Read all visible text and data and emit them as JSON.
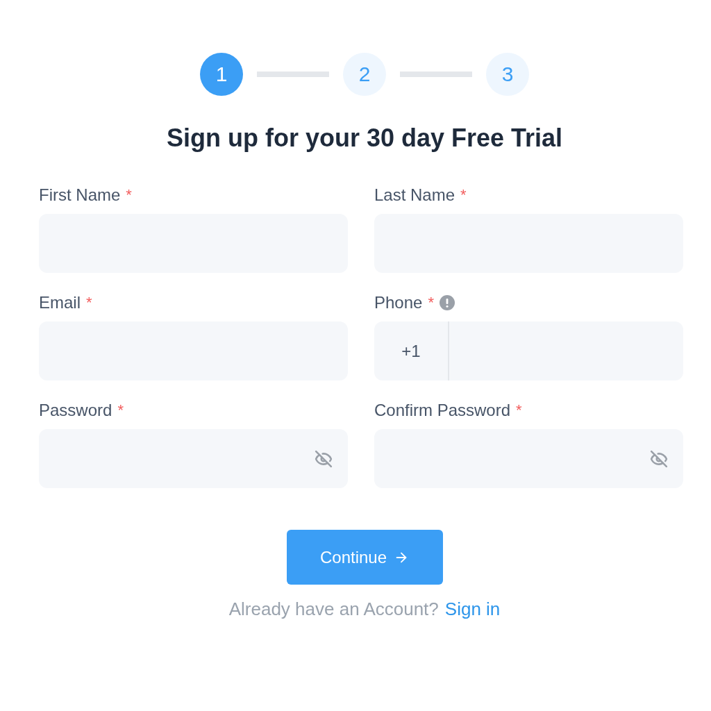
{
  "steps": [
    {
      "label": "1",
      "selected": true
    },
    {
      "label": "2",
      "selected": false
    },
    {
      "label": "3",
      "selected": false
    }
  ],
  "title": "Sign up for your 30 day Free Trial",
  "fields": [
    {
      "label": "First Name",
      "marker": "*",
      "kind": "text"
    },
    {
      "label": "Last Name",
      "marker": "*",
      "kind": "text"
    },
    {
      "label": "Email",
      "marker": "*",
      "kind": "text"
    },
    {
      "label": "Phone",
      "marker": "*",
      "kind": "phone",
      "prefix": "+1",
      "info": true
    },
    {
      "label": "Password",
      "marker": "*",
      "kind": "password"
    },
    {
      "label": "Confirm Password",
      "marker": "*",
      "kind": "password"
    }
  ],
  "button": {
    "label": "Continue"
  },
  "footer": {
    "text": "Already have an Account?",
    "link": "Sign in"
  }
}
